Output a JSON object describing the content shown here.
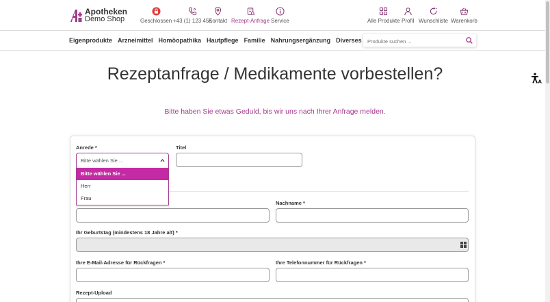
{
  "brand": {
    "line1": "Apotheken",
    "line2": "Demo Shop",
    "accent": "#a33a8d",
    "selected_bg": "#c32aa3"
  },
  "header_left": [
    {
      "label": "Geschlossen",
      "icon": "lock-icon"
    },
    {
      "label": "+43 (1) 123 456",
      "icon": "phone-icon"
    },
    {
      "label": "Kontakt",
      "icon": "location-pin-icon"
    },
    {
      "label": "Rezept-Anfrage",
      "icon": "prescription-icon"
    },
    {
      "label": "Service",
      "icon": "info-icon"
    }
  ],
  "header_right": [
    {
      "label": "Alle Produkte",
      "icon": "grid-icon"
    },
    {
      "label": "Profil",
      "icon": "user-icon"
    },
    {
      "label": "Wunschliste",
      "icon": "heart-refresh-icon"
    },
    {
      "label": "Warenkorb",
      "icon": "basket-icon"
    }
  ],
  "categories": [
    "Eigenprodukte",
    "Arzneimittel",
    "Homöopathika",
    "Hautpflege",
    "Familie",
    "Nahrungsergänzung",
    "Diverses"
  ],
  "search": {
    "placeholder": "Produkte suchen ..."
  },
  "page": {
    "title": "Rezeptanfrage / Medikamente vorbestellen?",
    "subtitle": "Bitte haben Sie etwas Geduld, bis wir uns nach Ihrer Anfrage melden."
  },
  "form": {
    "anrede_label": "Anrede *",
    "anrede_value": "Bitte wählen Sie ...",
    "anrede_options": [
      "Bitte wählen Sie ...",
      "Herr",
      "Frau"
    ],
    "titel_label": "Titel",
    "nachname_label": "Nachname *",
    "geburtstag_label": "Ihr Geburtstag (mindestens 18 Jahre alt) *",
    "email_label": "Ihre E-Mail-Adresse für Rückfragen *",
    "telefon_label": "Ihre Telefonnummer für Rückfragen *",
    "upload_label": "Rezept-Upload"
  }
}
